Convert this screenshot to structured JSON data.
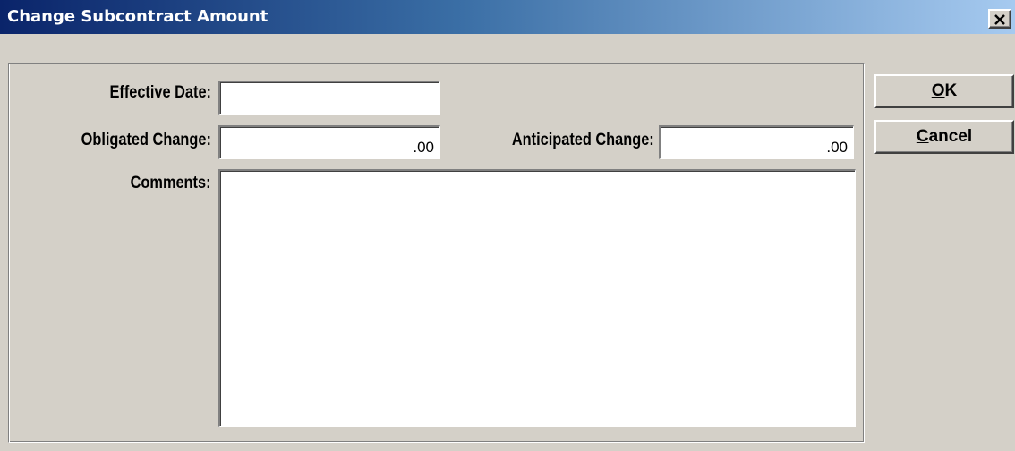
{
  "window": {
    "title": "Change Subcontract Amount",
    "close_icon": "close-icon"
  },
  "form": {
    "effective_date": {
      "label": "Effective Date:",
      "value": ""
    },
    "obligated_change": {
      "label": "Obligated Change:",
      "value": ".00"
    },
    "anticipated_change": {
      "label": "Anticipated Change:",
      "value": ".00"
    },
    "comments": {
      "label": "Comments:",
      "value": ""
    }
  },
  "buttons": {
    "ok": {
      "mnemonic": "O",
      "rest": "K"
    },
    "cancel": {
      "mnemonic": "C",
      "rest": "ancel"
    }
  },
  "colors": {
    "titlebar_start": "#0a246a",
    "titlebar_end": "#a6caf0",
    "face": "#d4d0c8"
  }
}
